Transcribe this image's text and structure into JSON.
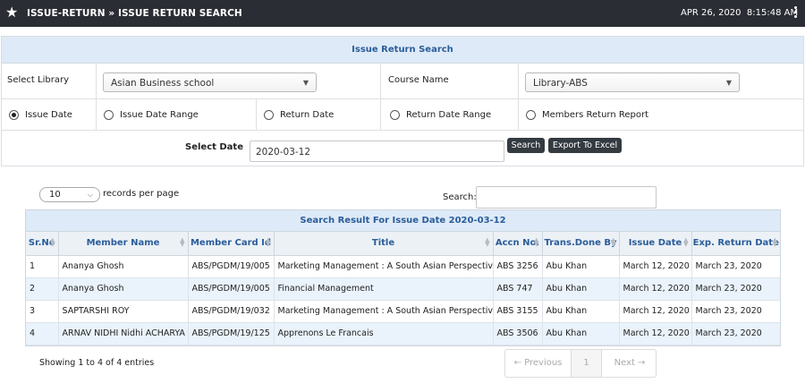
{
  "header": {
    "title": "ISSUE-RETURN » ISSUE RETURN SEARCH",
    "date": "APR 26, 2020",
    "time": "8:15:48 AM"
  },
  "panel": {
    "title": "Issue Return Search",
    "select_library_label": "Select Library",
    "library_value": "Asian Business school",
    "course_label": "Course Name",
    "course_value": "Library-ABS",
    "radios": [
      {
        "label": "Issue Date",
        "checked": true
      },
      {
        "label": "Issue Date Range",
        "checked": false
      },
      {
        "label": "Return Date",
        "checked": false
      },
      {
        "label": "Return Date Range",
        "checked": false
      },
      {
        "label": "Members Return Report",
        "checked": false
      }
    ],
    "select_date_label": "Select Date",
    "date_value": "2020-03-12",
    "search_button": "Search",
    "export_button": "Export To Excel"
  },
  "table_controls": {
    "page_length": "10",
    "records_label": "records per page",
    "search_label": "Search:"
  },
  "grid": {
    "caption": "Search Result For Issue Date 2020-03-12",
    "columns": [
      "Sr.No",
      "Member Name",
      "Member Card Id",
      "Title",
      "Accn No.",
      "Trans.Done By",
      "Issue Date",
      "Exp. Return Date"
    ],
    "rows": [
      [
        "1",
        "Ananya Ghosh",
        "ABS/PGDM/19/005",
        "Marketing Management : A South Asian Perspective",
        "ABS 3256",
        "Abu Khan",
        "March 12, 2020",
        "March 23, 2020"
      ],
      [
        "2",
        "Ananya Ghosh",
        "ABS/PGDM/19/005",
        "Financial Management",
        "ABS 747",
        "Abu Khan",
        "March 12, 2020",
        "March 23, 2020"
      ],
      [
        "3",
        "SAPTARSHI ROY",
        "ABS/PGDM/19/032",
        "Marketing Management : A South Asian Perspective",
        "ABS 3155",
        "Abu Khan",
        "March 12, 2020",
        "March 23, 2020"
      ],
      [
        "4",
        "ARNAV NIDHI Nidhi ACHARYA",
        "ABS/PGDM/19/125",
        "Apprenons Le Francais",
        "ABS 3506",
        "Abu Khan",
        "March 12, 2020",
        "March 23, 2020"
      ]
    ]
  },
  "footer": {
    "info": "Showing 1 to 4 of 4 entries",
    "previous": "← Previous",
    "page": "1",
    "next": "Next →"
  }
}
